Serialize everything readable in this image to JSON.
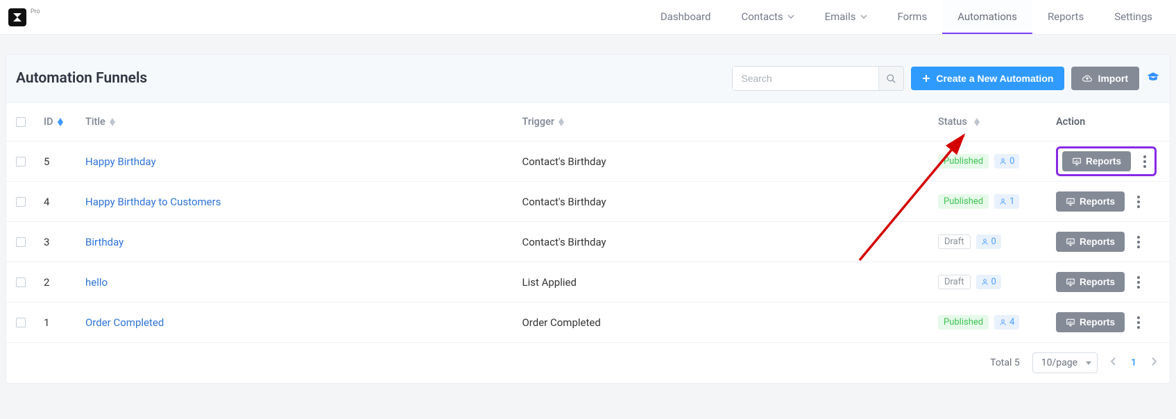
{
  "header": {
    "logo_badge": "Pro",
    "nav": [
      {
        "label": "Dashboard",
        "dropdown": false
      },
      {
        "label": "Contacts",
        "dropdown": true
      },
      {
        "label": "Emails",
        "dropdown": true
      },
      {
        "label": "Forms",
        "dropdown": false
      },
      {
        "label": "Automations",
        "dropdown": false,
        "active": true
      },
      {
        "label": "Reports",
        "dropdown": false
      },
      {
        "label": "Settings",
        "dropdown": false
      }
    ]
  },
  "panel": {
    "title": "Automation Funnels",
    "search_placeholder": "Search",
    "create_label": "Create a New Automation",
    "import_label": "Import"
  },
  "columns": {
    "id": "ID",
    "title": "Title",
    "trigger": "Trigger",
    "status": "Status",
    "action": "Action",
    "reports_btn": "Reports"
  },
  "rows": [
    {
      "id": "5",
      "title": "Happy Birthday",
      "trigger": "Contact's Birthday",
      "status": "Published",
      "count": "0",
      "highlight": true
    },
    {
      "id": "4",
      "title": "Happy Birthday to Customers",
      "trigger": "Contact's Birthday",
      "status": "Published",
      "count": "1"
    },
    {
      "id": "3",
      "title": "Birthday",
      "trigger": "Contact's Birthday",
      "status": "Draft",
      "count": "0"
    },
    {
      "id": "2",
      "title": "hello",
      "trigger": "List Applied",
      "status": "Draft",
      "count": "0"
    },
    {
      "id": "1",
      "title": "Order Completed",
      "trigger": "Order Completed",
      "status": "Published",
      "count": "4"
    }
  ],
  "footer": {
    "total_label": "Total 5",
    "per_page": "10/page",
    "current_page": "1"
  }
}
